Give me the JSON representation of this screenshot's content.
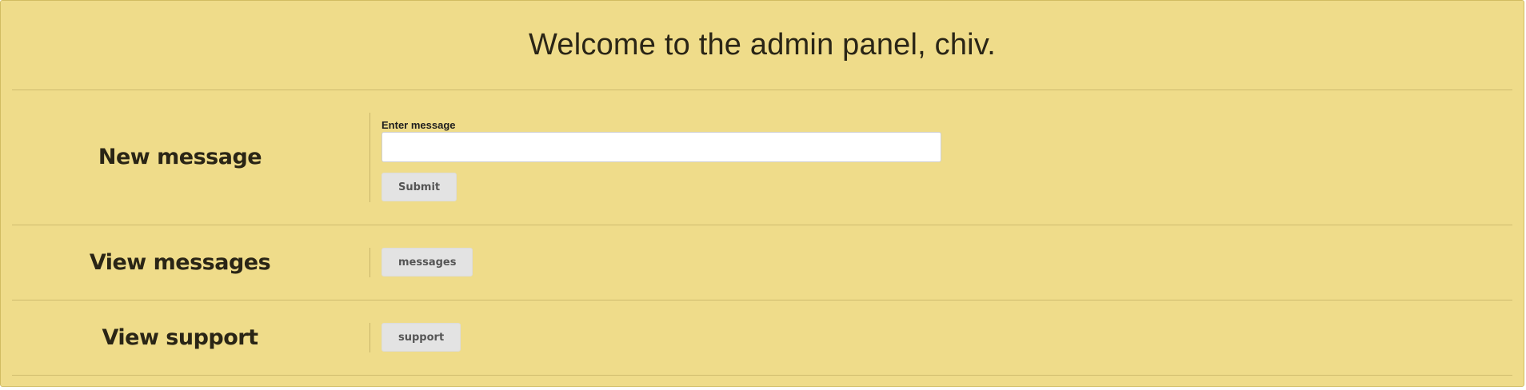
{
  "header": {
    "title": "Welcome to the admin panel, chiv."
  },
  "new_message": {
    "label": "New message",
    "field_label": "Enter message",
    "input_value": "",
    "input_placeholder": "",
    "submit_label": "Submit"
  },
  "view_messages": {
    "label": "View messages",
    "button_label": "messages"
  },
  "view_support": {
    "label": "View support",
    "button_label": "support"
  },
  "colors": {
    "panel_background": "#efdc8a",
    "button_background": "#e3e3e3",
    "text": "#2a2516"
  }
}
